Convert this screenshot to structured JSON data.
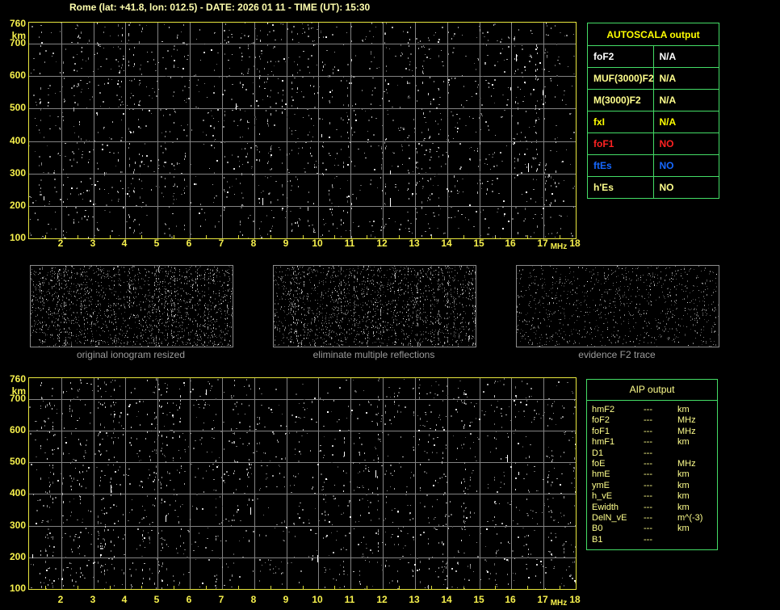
{
  "header": {
    "title": "Rome (lat: +41.8, lon: 012.5) - DATE: 2026 01 11 - TIME (UT): 15:30"
  },
  "axis": {
    "x_unit": "MHz",
    "y_unit": "km",
    "x_ticks": [
      "2",
      "3",
      "4",
      "5",
      "6",
      "7",
      "8",
      "9",
      "10",
      "11",
      "12",
      "13",
      "14",
      "15",
      "16",
      "17",
      "18"
    ],
    "y_ticks": [
      "760",
      "700",
      "600",
      "500",
      "400",
      "300",
      "200",
      "100"
    ],
    "x_min": 1,
    "x_max": 18,
    "y_max": 760
  },
  "thumbnails": [
    {
      "caption": "original ionogram resized"
    },
    {
      "caption": "eliminate multiple reflections"
    },
    {
      "caption": "evidence F2 trace"
    }
  ],
  "autoscala": {
    "header": "AUTOSCALA output",
    "rows": [
      {
        "label": "foF2",
        "value": "N/A",
        "color": "#ffffff"
      },
      {
        "label": "MUF(3000)F2",
        "value": "N/A",
        "color": "#ffff8c"
      },
      {
        "label": "M(3000)F2",
        "value": "N/A",
        "color": "#ffff8c"
      },
      {
        "label": "fxI",
        "value": "N/A",
        "color": "#ffff00"
      },
      {
        "label": "foF1",
        "value": "NO",
        "color": "#ff2222"
      },
      {
        "label": "ftEs",
        "value": "NO",
        "color": "#1668ff"
      },
      {
        "label": "h'Es",
        "value": "NO",
        "color": "#ffff8c"
      }
    ]
  },
  "aip": {
    "header": "AIP output",
    "rows": [
      {
        "label": "hmF2",
        "value": "---",
        "unit": "km"
      },
      {
        "label": "foF2",
        "value": "---",
        "unit": "MHz"
      },
      {
        "label": "foF1",
        "value": "---",
        "unit": "MHz"
      },
      {
        "label": "hmF1",
        "value": "---",
        "unit": "km"
      },
      {
        "label": "D1",
        "value": "---",
        "unit": ""
      },
      {
        "label": "foE",
        "value": "---",
        "unit": "MHz"
      },
      {
        "label": "hmE",
        "value": "---",
        "unit": "km"
      },
      {
        "label": "ymE",
        "value": "---",
        "unit": "km"
      },
      {
        "label": "h_vE",
        "value": "---",
        "unit": "km"
      },
      {
        "label": "Ewidth",
        "value": "---",
        "unit": "km"
      },
      {
        "label": "DelN_vE",
        "value": "---",
        "unit": "m^(-3)"
      },
      {
        "label": "B0",
        "value": "---",
        "unit": "km"
      },
      {
        "label": "B1",
        "value": "---",
        "unit": ""
      }
    ]
  },
  "colors": {
    "axis_yellow": "#f6f04c",
    "frame_yellow": "#e9e73e",
    "grid_gray": "#828282",
    "table_green": "#44dd66",
    "pale_yellow": "#ffff8c",
    "title_yellow": "#ffffae",
    "caption_gray": "#9c9c9c"
  }
}
